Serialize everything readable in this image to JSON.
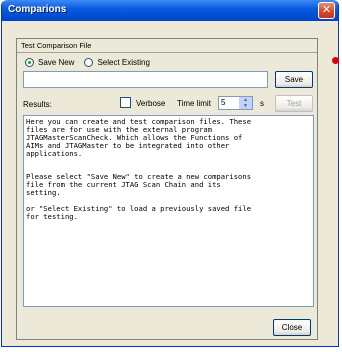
{
  "window": {
    "title": "Comparions",
    "close_symbol": "✕"
  },
  "group": {
    "header": "Test Comparison File"
  },
  "mode": {
    "options": [
      {
        "label": "Save New",
        "selected": true
      },
      {
        "label": "Select Existing",
        "selected": false
      }
    ]
  },
  "path_input": {
    "value": ""
  },
  "buttons": {
    "save": "Save",
    "test": "Test",
    "close": "Close"
  },
  "results": {
    "label": "Results:",
    "verbose_label": "Verbose",
    "verbose_checked": false,
    "time_limit_label": "Time limit",
    "time_limit_value": "5",
    "time_unit": "s",
    "text": "Here you can create and test comparison files. These\nfiles are for use with the external program\nJTAGMasterScanCheck. Which allows the Functions of\nAIMs and JTAGMaster to be integrated into other\napplications.\n\n\nPlease select \"Save New\" to create a new comparisons\nfile from the current JTAG Scan Chain and its\nsetting.\n\nor \"Select Existing\" to load a previously saved file\nfor testing."
  },
  "colors": {
    "title_bar": "#0a5de1",
    "window_bg": "#ece9d8",
    "close_button": "#d8462a",
    "radio_dot": "#21a121",
    "marker": "#e00000"
  }
}
